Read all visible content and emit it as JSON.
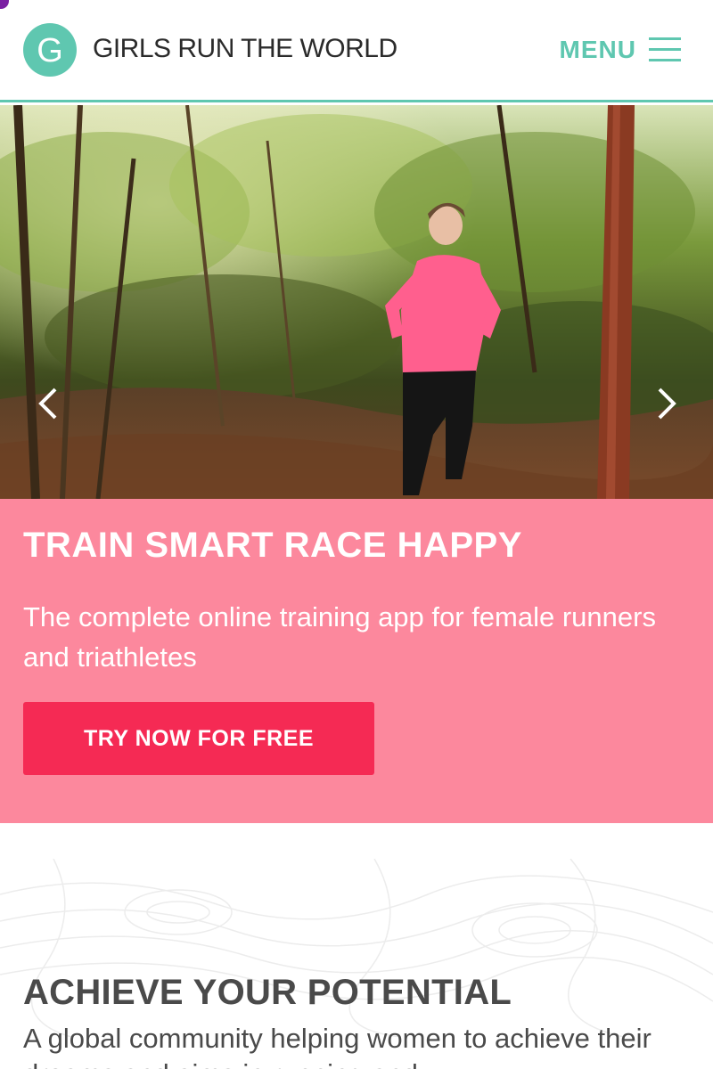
{
  "header": {
    "logo_letter": "G",
    "brand": "GIRLS RUN THE WORLD",
    "menu_label": "MENU"
  },
  "hero": {
    "prev_icon": "chevron-left-icon",
    "next_icon": "chevron-right-icon"
  },
  "promo": {
    "title": "TRAIN SMART RACE HAPPY",
    "subtitle": "The complete online training app for female runners and triathletes",
    "cta_label": "TRY NOW FOR FREE"
  },
  "section": {
    "title": "ACHIEVE YOUR POTENTIAL",
    "body": "A global community helping women to achieve their dreams and aims in running and"
  },
  "colors": {
    "teal": "#5fc7b0",
    "pink": "#fc889d",
    "cta": "#f52a54",
    "text_dark": "#4a4a4a"
  }
}
